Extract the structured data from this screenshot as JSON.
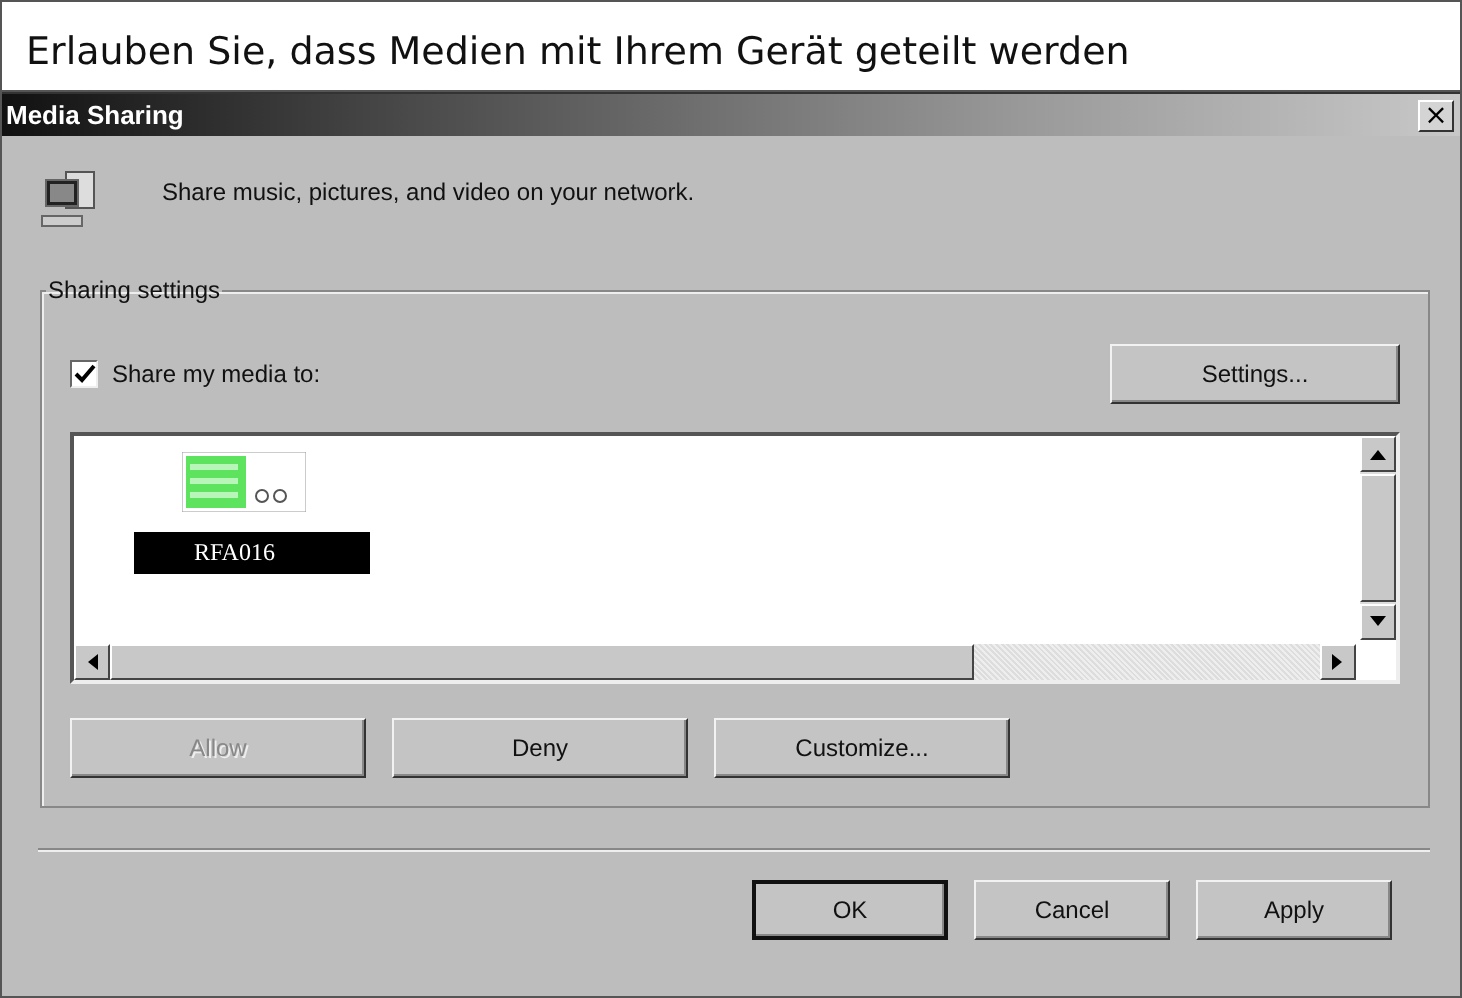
{
  "heading": "Erlauben Sie, dass Medien mit Ihrem Gerät geteilt werden",
  "window": {
    "title": "Media Sharing",
    "close": "×"
  },
  "intro": "Share music, pictures, and video on your network.",
  "group": {
    "label": "Sharing settings"
  },
  "share": {
    "label": "Share my media to:",
    "checked": true
  },
  "settings_button": "Settings...",
  "devices": [
    {
      "label": "RFA016",
      "selected": true
    }
  ],
  "action_buttons": [
    {
      "label": "Allow",
      "disabled": true
    },
    {
      "label": "Deny",
      "disabled": false
    },
    {
      "label": "Customize...",
      "disabled": false
    }
  ],
  "footer_buttons": [
    {
      "label": "OK",
      "default": true
    },
    {
      "label": "Cancel",
      "default": false
    },
    {
      "label": "Apply",
      "default": false
    }
  ]
}
